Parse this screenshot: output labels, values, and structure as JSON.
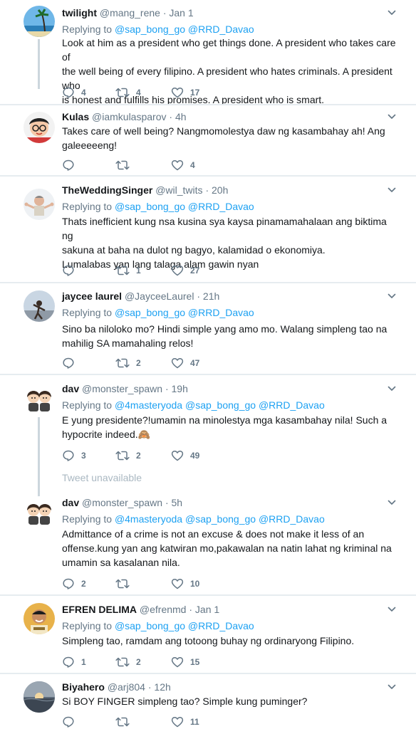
{
  "tweets": [
    {
      "name": "twilight",
      "handle": "@mang_rene",
      "dot": "·",
      "time": "Jan 1",
      "reply_prefix": "Replying to",
      "mentions": [
        "@sap_bong_go",
        "@RRD_Davao"
      ],
      "lines": [
        "Look at him as a president who get things done. A president who takes care of",
        "the well being of every filipino. A president who hates criminals. A president who",
        "is honest and fulfills his promises. A president who is smart."
      ],
      "replies": "4",
      "retweets": "4",
      "likes": "17",
      "avatar": "beach-photo"
    },
    {
      "name": "Kulas",
      "handle": "@iamkulasparov",
      "dot": "·",
      "time": "4h",
      "reply_prefix": "",
      "mentions": [],
      "lines": [
        "Takes care of well being? Nangmomolestya daw ng kasambahay ah! Ang",
        "galeeeeeng!"
      ],
      "replies": "",
      "retweets": "",
      "likes": "4",
      "avatar": "cartoon-glasses"
    },
    {
      "name": "TheWeddingSinger",
      "handle": "@wil_twits",
      "dot": "·",
      "time": "20h",
      "reply_prefix": "Replying to",
      "mentions": [
        "@sap_bong_go",
        "@RRD_Davao"
      ],
      "lines": [
        "Thats inefficient kung nsa kusina sya kaysa pinamamahalaan ang biktima ng",
        "sakuna at baha na dulot ng bagyo, kalamidad o ekonomiya.",
        "Lumalabas yan lang talaga alam gawin nyan"
      ],
      "replies": "",
      "retweets": "1",
      "likes": "27",
      "avatar": "man-arms-out"
    },
    {
      "name": "jaycee laurel",
      "handle": "@JayceeLaurel",
      "dot": "·",
      "time": "21h",
      "reply_prefix": "Replying to",
      "mentions": [
        "@sap_bong_go",
        "@RRD_Davao"
      ],
      "lines": [
        "Sino ba niloloko mo? Hindi simple yang amo mo. Walang simpleng tao na",
        "mahilig SA mamahaling relos!"
      ],
      "replies": "",
      "retweets": "2",
      "likes": "47",
      "avatar": "person-outdoor"
    },
    {
      "name": "dav",
      "handle": "@monster_spawn",
      "dot": "·",
      "time": "19h",
      "reply_prefix": "Replying to",
      "mentions": [
        "@4masteryoda",
        "@sap_bong_go",
        "@RRD_Davao"
      ],
      "lines": [
        "E yung presidente?!umamin na minolestya mga kasambahay nila! Such a",
        "hypocrite indeed.🙈"
      ],
      "replies": "3",
      "retweets": "2",
      "likes": "49",
      "avatar": "cartoon-duo"
    },
    {
      "name": "dav",
      "handle": "@monster_spawn",
      "dot": "·",
      "time": "5h",
      "reply_prefix": "Replying to",
      "mentions": [
        "@4masteryoda",
        "@sap_bong_go",
        "@RRD_Davao"
      ],
      "lines": [
        "Admittance of a crime is not an excuse & does not make it less of an",
        "offense.kung yan ang katwiran mo,pakawalan na natin lahat ng kriminal na",
        "umamin sa kasalanan nila."
      ],
      "replies": "2",
      "retweets": "",
      "likes": "10",
      "avatar": "cartoon-duo"
    },
    {
      "name": "EFREN DELIMA",
      "handle": "@efrenmd",
      "dot": "·",
      "time": "Jan 1",
      "reply_prefix": "Replying to",
      "mentions": [
        "@sap_bong_go",
        "@RRD_Davao"
      ],
      "lines": [
        "Simpleng tao, ramdam ang totoong buhay ng ordinaryong Filipino."
      ],
      "replies": "1",
      "retweets": "2",
      "likes": "15",
      "avatar": "man-smiling"
    },
    {
      "name": "Biyahero",
      "handle": "@arj804",
      "dot": "·",
      "time": "12h",
      "reply_prefix": "",
      "mentions": [],
      "lines": [
        "Si BOY FINGER simpleng tao? Simple kung puminger?"
      ],
      "replies": "",
      "retweets": "",
      "likes": "11",
      "avatar": "sunset"
    }
  ],
  "unavailable": "Tweet unavailable",
  "colors": {
    "link": "#1da1f2",
    "muted": "#657786",
    "text": "#14171a",
    "border": "#e6ecf0",
    "connector": "#ccd6dd"
  }
}
